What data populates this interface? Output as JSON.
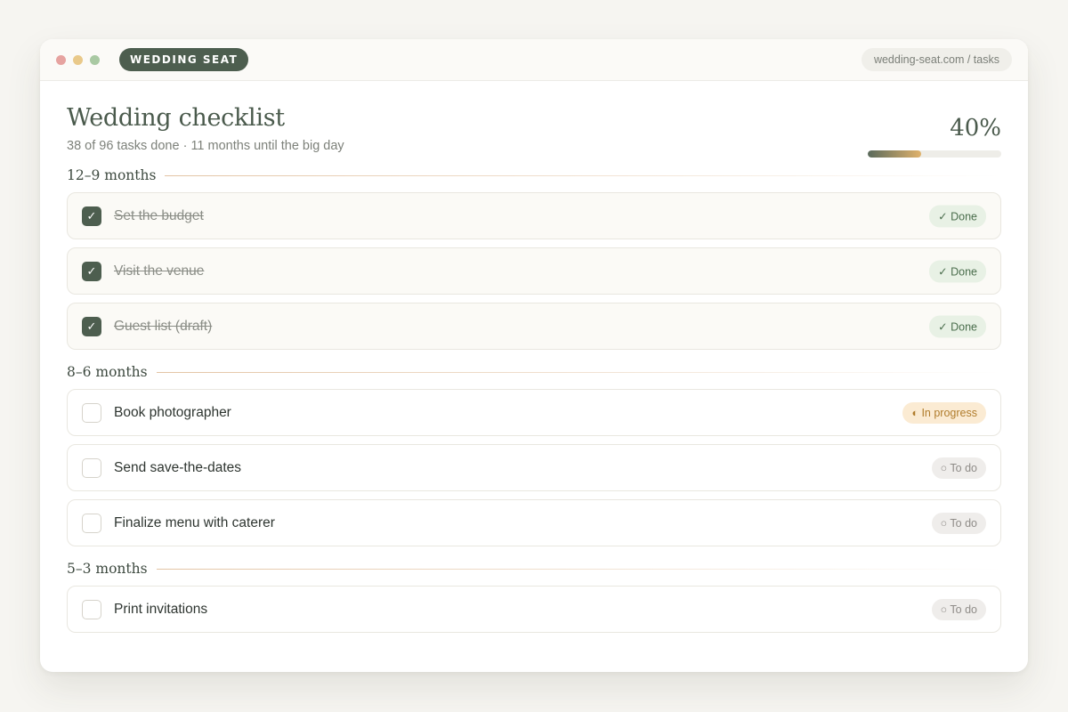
{
  "window": {
    "brand": "WEDDING SEAT",
    "url": "wedding-seat.com / tasks"
  },
  "header": {
    "title": "Wedding checklist",
    "subtitle": "38 of 96 tasks done · 11 months until the big day",
    "progress_label": "40%",
    "progress_fraction": 0.4
  },
  "sections": [
    {
      "label": "12–9 months",
      "tasks": [
        {
          "label": "Set the budget",
          "status": "✓ Done",
          "state": "done",
          "check": "✓"
        },
        {
          "label": "Visit the venue",
          "status": "✓ Done",
          "state": "done",
          "check": "✓"
        },
        {
          "label": "Guest list (draft)",
          "status": "✓ Done",
          "state": "done",
          "check": "✓"
        }
      ]
    },
    {
      "label": "8–6 months",
      "tasks": [
        {
          "label": "Book photographer",
          "status": "◐ In progress",
          "state": "progress",
          "check": ""
        },
        {
          "label": "Send save-the-dates",
          "status": "○ To do",
          "state": "todo",
          "check": ""
        },
        {
          "label": "Finalize menu with caterer",
          "status": "○ To do",
          "state": "todo",
          "check": ""
        }
      ]
    },
    {
      "label": "5–3 months",
      "tasks": [
        {
          "label": "Print invitations",
          "status": "○ To do",
          "state": "todo",
          "check": ""
        }
      ]
    }
  ],
  "colors": {
    "accent": "#4d5e4f",
    "done_badge": "#e8f1e5",
    "progress_badge": "#fbebd3",
    "todo_badge": "#efedeb"
  }
}
